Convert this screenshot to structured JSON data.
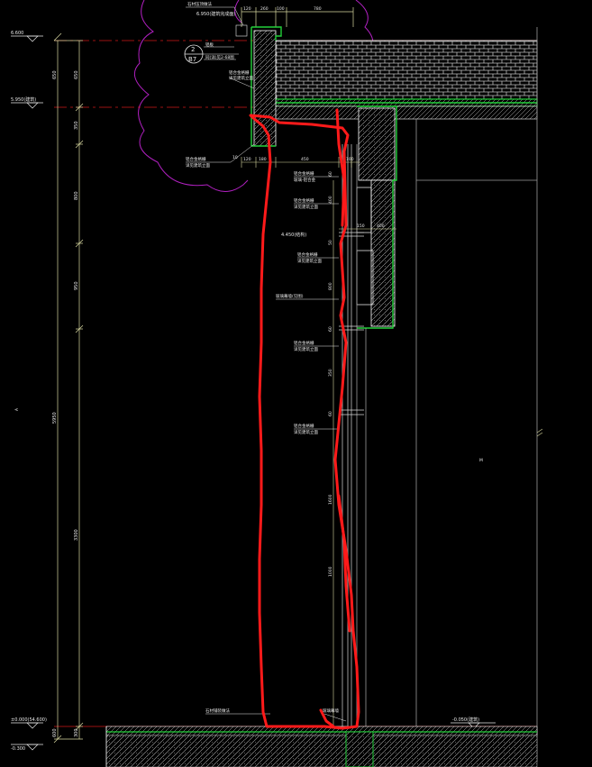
{
  "drawing": {
    "colors": {
      "background": "#000000",
      "dimension": "#d8d8a0",
      "wall": "#ffffff",
      "green": "#22d13a",
      "red_markup": "#ff1a1a",
      "magenta_tree": "#b020c0",
      "hatch": "#c8c8c8",
      "grid_red": "#d01818",
      "frame_gray": "#9a9a9a"
    },
    "elevations": {
      "top": "6.600",
      "mid_left": "5.950(建筑)",
      "bottom_left": "±0.000(54.600)",
      "bottom_left2": "-0.300",
      "bottom_right": "-0.050(建筑)",
      "mid_annot": "4.450(结构)",
      "top_annot": "6.950(建筑完成面)"
    },
    "left_dims": {
      "d1": "650",
      "d2": "350",
      "d3": "800",
      "d4": "950",
      "d5": "5950",
      "d6": "3300",
      "d7": "300",
      "d8": "600",
      "small": "60"
    },
    "top_dims": {
      "a": "120",
      "b": "260",
      "c": "100",
      "d": "780"
    },
    "mid_dims": {
      "a": "120",
      "b": "180",
      "c": "450",
      "d": "100",
      "e": "150",
      "f": "400",
      "g": "10"
    },
    "vert_dims": {
      "v1": "60",
      "v2": "400",
      "v3": "50",
      "v4": "800",
      "v5": "60",
      "v6": "350",
      "v7": "60",
      "v8": "1600",
      "v9": "60",
      "v10": "1000"
    },
    "detail": {
      "number": "2",
      "sheet": "B7"
    },
    "notes": {
      "n1": "石材压顶做法",
      "n2": "铝板",
      "n3": "同(详)见2-68图",
      "n4": "铝合金格栅",
      "n5": "详见建筑立面",
      "n6": "铝合金格栅",
      "n7": "详见建筑立面",
      "n8": "铝合金格栅",
      "n9": "玻璃-铝合金",
      "n10": "铝合金格栅",
      "n11": "详见建筑立面",
      "n12": "玻璃幕墙(见图)",
      "n13": "铝合金格栅",
      "n14": "详见建筑立面",
      "n15": "铝合金格栅",
      "n16": "详见建筑立面",
      "n17": "石材铺装做法",
      "n18": "玻璃幕墙",
      "n19": "铝合金格栅",
      "n20": "详见建筑立面"
    },
    "axis_marker": "A",
    "right_mark": "M"
  }
}
